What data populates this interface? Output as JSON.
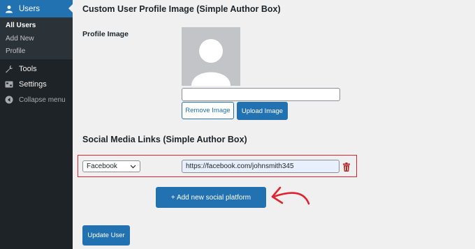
{
  "sidebar": {
    "users_label": "Users",
    "submenu": [
      "All Users",
      "Add New",
      "Profile"
    ],
    "tools_label": "Tools",
    "settings_label": "Settings",
    "collapse_label": "Collapse menu"
  },
  "profile_image": {
    "heading": "Custom User Profile Image (Simple Author Box)",
    "label": "Profile Image",
    "url_value": "",
    "remove_label": "Remove Image",
    "upload_label": "Upload Image"
  },
  "social": {
    "heading": "Social Media Links (Simple Author Box)",
    "platform_selected": "Facebook",
    "url_value": "https://facebook.com/johnsmith345",
    "add_label": "+ Add new social platform"
  },
  "update_label": "Update User",
  "colors": {
    "accent": "#2271b1",
    "sidebar_bg": "#1d2327",
    "highlight": "#e0242f",
    "delete_icon": "#b32d2e"
  },
  "icons": [
    "users-icon",
    "tools-icon",
    "settings-icon",
    "collapse-icon",
    "chevron-down-icon",
    "trash-icon",
    "red-arrow-icon"
  ]
}
